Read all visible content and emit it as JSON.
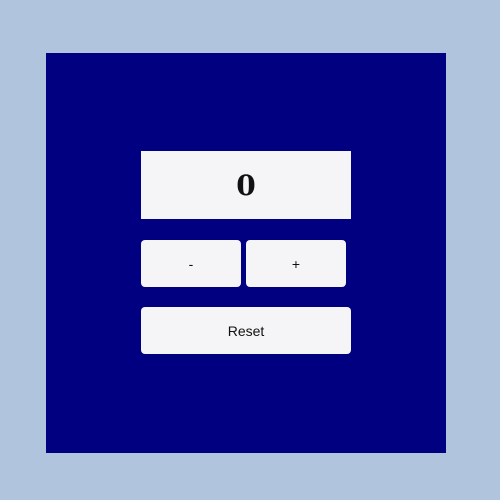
{
  "counter": {
    "value": "0"
  },
  "buttons": {
    "decrement_label": "-",
    "increment_label": "+",
    "reset_label": "Reset"
  },
  "colors": {
    "page_background": "#b0c4de",
    "panel_background": "#000080",
    "control_background": "#f5f5f7"
  }
}
